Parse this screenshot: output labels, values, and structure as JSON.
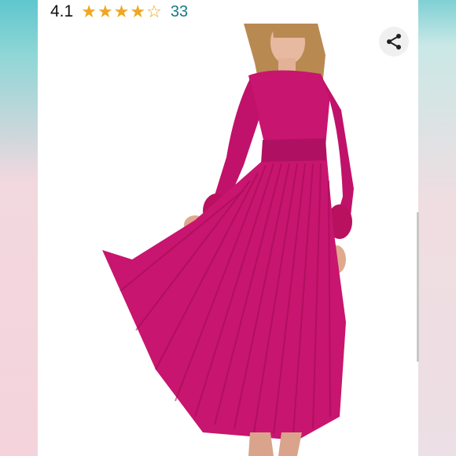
{
  "rating": {
    "score": "4.1",
    "stars_value": 4.1,
    "stars_out_of": 5,
    "review_count": "33",
    "star_color": "#f0a620",
    "count_color": "#137a86"
  },
  "product_image": {
    "icon": "dress-photo",
    "dress_color": "#c8156f"
  },
  "share_icon": "share-icon"
}
